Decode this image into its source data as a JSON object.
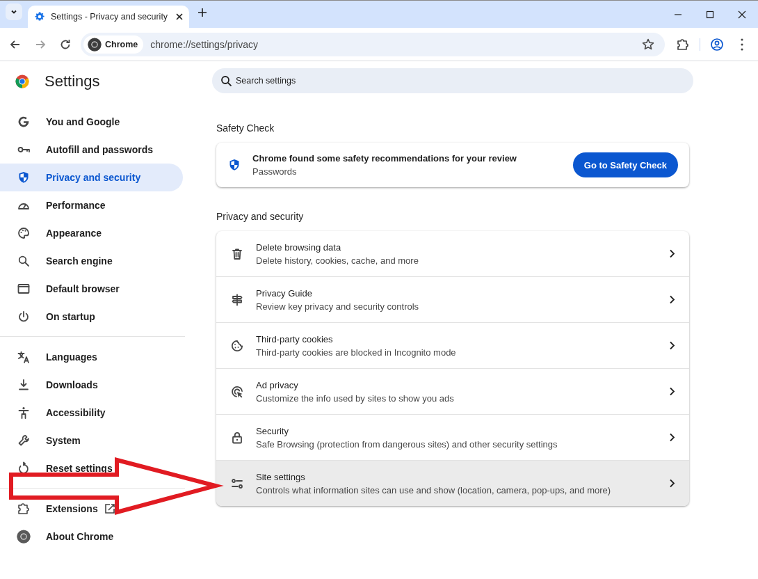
{
  "tab_strip": {
    "tabs": [
      {
        "title": "Settings - Privacy and security",
        "selected": true
      }
    ]
  },
  "toolbar": {
    "origin_chip": "Chrome",
    "url": "chrome://settings/privacy"
  },
  "sidebar": {
    "title": "Settings",
    "items": [
      {
        "label": "You and Google",
        "selected": false
      },
      {
        "label": "Autofill and passwords",
        "selected": false
      },
      {
        "label": "Privacy and security",
        "selected": true
      },
      {
        "label": "Performance",
        "selected": false
      },
      {
        "label": "Appearance",
        "selected": false
      },
      {
        "label": "Search engine",
        "selected": false
      },
      {
        "label": "Default browser",
        "selected": false
      },
      {
        "label": "On startup",
        "selected": false
      }
    ],
    "advanced_items": [
      {
        "label": "Languages",
        "selected": false
      },
      {
        "label": "Downloads",
        "selected": false
      },
      {
        "label": "Accessibility",
        "selected": false
      },
      {
        "label": "System",
        "selected": false
      },
      {
        "label": "Reset settings",
        "selected": false
      }
    ],
    "footer_items": [
      {
        "label": "Extensions",
        "kind": "external"
      },
      {
        "label": "About Chrome",
        "kind": "page"
      }
    ]
  },
  "search": {
    "placeholder": "Search settings"
  },
  "safety_check": {
    "heading": "Safety Check",
    "title": "Chrome found some safety recommendations for your review",
    "subtitle": "Passwords",
    "button": "Go to Safety Check"
  },
  "privacy_section": {
    "heading": "Privacy and security",
    "rows": [
      {
        "title": "Delete browsing data",
        "subtitle": "Delete history, cookies, cache, and more",
        "hovered": false
      },
      {
        "title": "Privacy Guide",
        "subtitle": "Review key privacy and security controls",
        "hovered": false
      },
      {
        "title": "Third-party cookies",
        "subtitle": "Third-party cookies are blocked in Incognito mode",
        "hovered": false
      },
      {
        "title": "Ad privacy",
        "subtitle": "Customize the info used by sites to show you ads",
        "hovered": false
      },
      {
        "title": "Security",
        "subtitle": "Safe Browsing (protection from dangerous sites) and other security settings",
        "hovered": false
      },
      {
        "title": "Site settings",
        "subtitle": "Controls what information sites can use and show (location, camera, pop-ups, and more)",
        "hovered": true
      }
    ]
  }
}
